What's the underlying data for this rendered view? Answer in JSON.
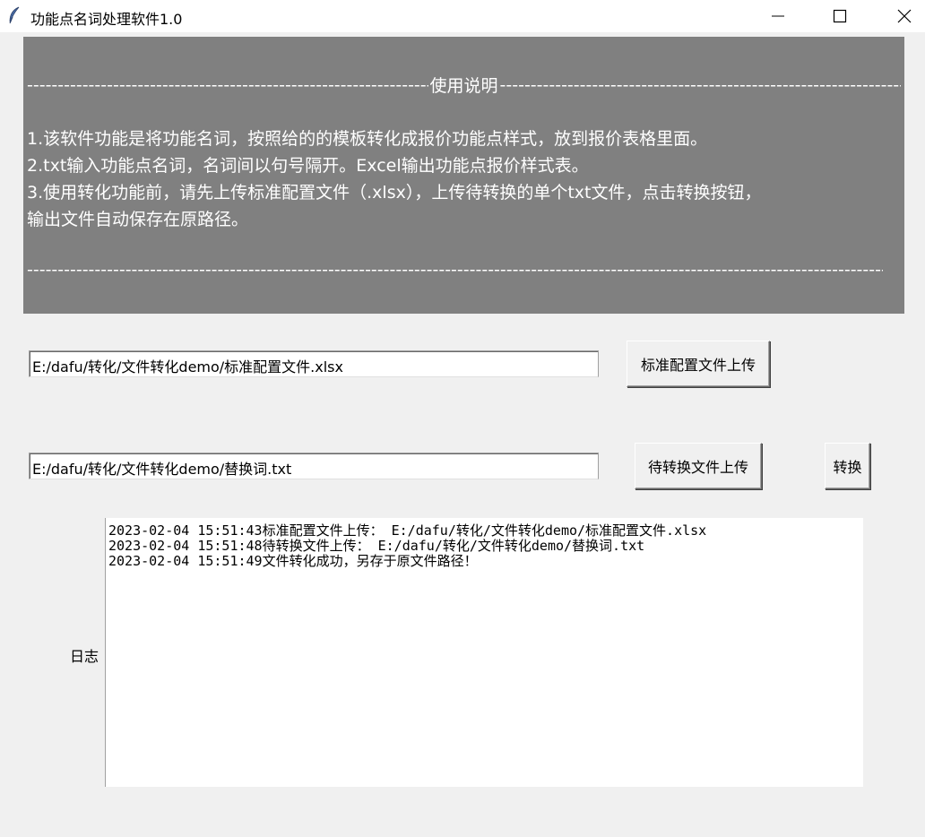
{
  "window": {
    "title": "功能点名词处理软件1.0",
    "icon": "feather-icon",
    "controls": [
      "minimize-icon",
      "maximize-icon",
      "close-icon"
    ]
  },
  "instructions": {
    "header_title": "使用说明",
    "lines": [
      "1.该软件功能是将功能名词，按照给的的模板转化成报价功能点样式，放到报价表格里面。",
      "2.txt输入功能点名词，名词间以句号隔开。Excel输出功能点报价样式表。",
      "3.使用转化功能前，请先上传标准配置文件（.xlsx），上传待转换的单个txt文件，点击转换按钮，",
      "输出文件自动保存在原路径。"
    ],
    "background_color": "#808080",
    "text_color": "#ffffff"
  },
  "config_file": {
    "path_value": "E:/dafu/转化/文件转化demo/标准配置文件.xlsx",
    "button_label": "标准配置文件上传"
  },
  "txt_file": {
    "path_value": "E:/dafu/转化/文件转化demo/替换词.txt",
    "upload_button_label": "待转换文件上传",
    "convert_button_label": "转换"
  },
  "log": {
    "label": "日志",
    "lines": [
      "2023-02-04 15:51:43标准配置文件上传： E:/dafu/转化/文件转化demo/标准配置文件.xlsx",
      "2023-02-04 15:51:48待转换文件上传： E:/dafu/转化/文件转化demo/替换词.txt",
      "2023-02-04 15:51:49文件转化成功，另存于原文件路径！"
    ]
  }
}
